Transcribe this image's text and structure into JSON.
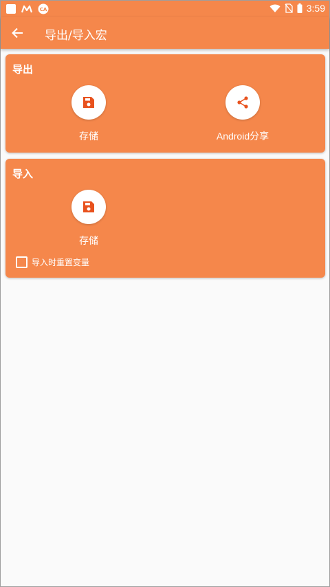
{
  "status_bar": {
    "time": "3:59",
    "icons": [
      "notification-square-icon",
      "m-app-icon",
      "ca-app-icon",
      "wifi-icon",
      "no-sim-icon",
      "battery-icon"
    ]
  },
  "app_bar": {
    "title": "导出/导入宏",
    "back_icon": "arrow-back-icon"
  },
  "export_card": {
    "title": "导出",
    "actions": [
      {
        "label": "存储",
        "icon": "save-icon"
      },
      {
        "label": "Android分享",
        "icon": "share-icon"
      }
    ]
  },
  "import_card": {
    "title": "导入",
    "actions": [
      {
        "label": "存储",
        "icon": "save-icon"
      }
    ],
    "checkbox": {
      "label": "导入时重置变量",
      "checked": false
    }
  },
  "colors": {
    "accent": "#f5874b",
    "icon": "#e8521e",
    "background": "#fafafa"
  }
}
